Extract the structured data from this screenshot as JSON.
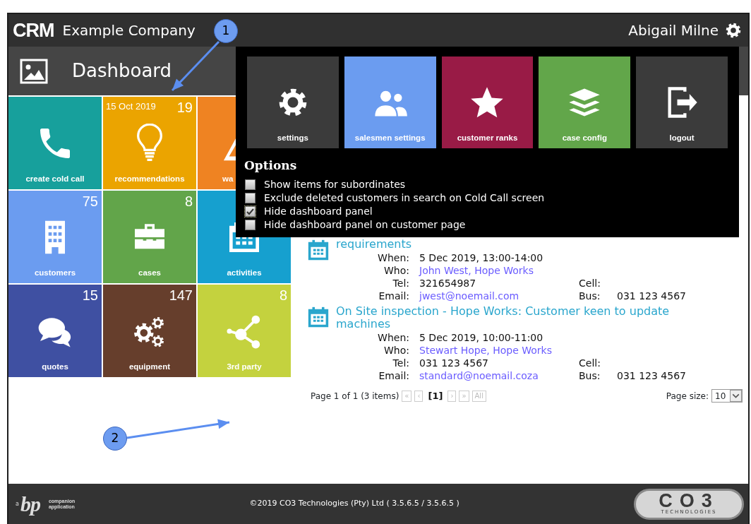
{
  "header": {
    "logo": "CRM",
    "company": "Example Company",
    "user": "Abigail Milne"
  },
  "page": {
    "title": "Dashboard"
  },
  "tiles": [
    {
      "label": "create cold call",
      "color": "#17a09c"
    },
    {
      "label": "recommendations",
      "date": "15 Oct 2019",
      "count": "19",
      "color": "#eba400"
    },
    {
      "label": "wa",
      "color": "#ef8322",
      "covered": true
    },
    {
      "label": "customers",
      "count": "75",
      "color": "#6b9cf0"
    },
    {
      "label": "cases",
      "count": "8",
      "color": "#62a54a"
    },
    {
      "label": "activities",
      "color": "#16a0cf"
    },
    {
      "label": "quotes",
      "count": "15",
      "color": "#3f50a2"
    },
    {
      "label": "equipment",
      "count": "147",
      "color": "#663e2c"
    },
    {
      "label": "3rd party",
      "count": "8",
      "color": "#c4d23e"
    }
  ],
  "menu": {
    "tiles": [
      {
        "label": "settings",
        "color": "#3b3b3b"
      },
      {
        "label": "salesmen settings",
        "color": "#6b9cf0"
      },
      {
        "label": "customer ranks",
        "color": "#991b46"
      },
      {
        "label": "case config",
        "color": "#62a64a"
      },
      {
        "label": "logout",
        "color": "#3b3b3b"
      }
    ],
    "options_title": "Options",
    "options": [
      {
        "label": "Show items for subordinates",
        "checked": false
      },
      {
        "label": "Exclude deleted customers in search on Cold Call screen",
        "checked": false
      },
      {
        "label": "Hide dashboard panel",
        "checked": true
      },
      {
        "label": "Hide dashboard panel on customer page",
        "checked": false
      }
    ]
  },
  "activities": [
    {
      "title": "requirements",
      "rows": [
        {
          "label": "When:",
          "value": "5 Dec 2019, 13:00-14:00",
          "kind": "text"
        },
        {
          "label": "Who:",
          "value": "John West, Hope Works",
          "kind": "link"
        },
        {
          "label": "Tel:",
          "value": "321654987",
          "kind": "text",
          "side_label": "Cell:"
        },
        {
          "label": "Email:",
          "value": "jwest@noemail.com",
          "kind": "link",
          "side_label": "Bus:",
          "side_value": "031 123 4567"
        }
      ]
    },
    {
      "title": "On Site inspection - Hope Works: Customer keen to update machines",
      "rows": [
        {
          "label": "When:",
          "value": "5 Dec 2019, 10:00-11:00",
          "kind": "text"
        },
        {
          "label": "Who:",
          "value": "Stewart Hope, Hope Works",
          "kind": "link"
        },
        {
          "label": "Tel:",
          "value": "031 123 4567",
          "kind": "text",
          "side_label": "Cell:"
        },
        {
          "label": "Email:",
          "value": "standard@noemail.coza",
          "kind": "link",
          "side_label": "Bus:",
          "side_value": "031 123 4567"
        }
      ]
    }
  ],
  "pager": {
    "summary": "Page 1 of 1 (3 items)",
    "buttons": [
      {
        "label": "«",
        "kind": "button",
        "disabled": true
      },
      {
        "label": "‹",
        "kind": "button",
        "disabled": true
      },
      {
        "label": "[1]",
        "kind": "current"
      },
      {
        "label": "›",
        "kind": "button",
        "disabled": true
      },
      {
        "label": "»",
        "kind": "button",
        "disabled": true
      },
      {
        "label": "All",
        "kind": "button",
        "disabled": true
      }
    ],
    "page_size_label": "Page size:",
    "page_size": "10"
  },
  "footer": {
    "partner_logo": {
      "prefix": "a",
      "mark": "bp",
      "lines": [
        "companion",
        "application"
      ]
    },
    "copyright": "©2019 CO3 Technologies (Pty) Ltd ( 3.5.6.5 / 3.5.6.5 )",
    "brand_logo": {
      "mark": "CO3",
      "sub": "TECHNOLOGIES"
    }
  },
  "annotations": [
    {
      "number": "1"
    },
    {
      "number": "2"
    }
  ]
}
